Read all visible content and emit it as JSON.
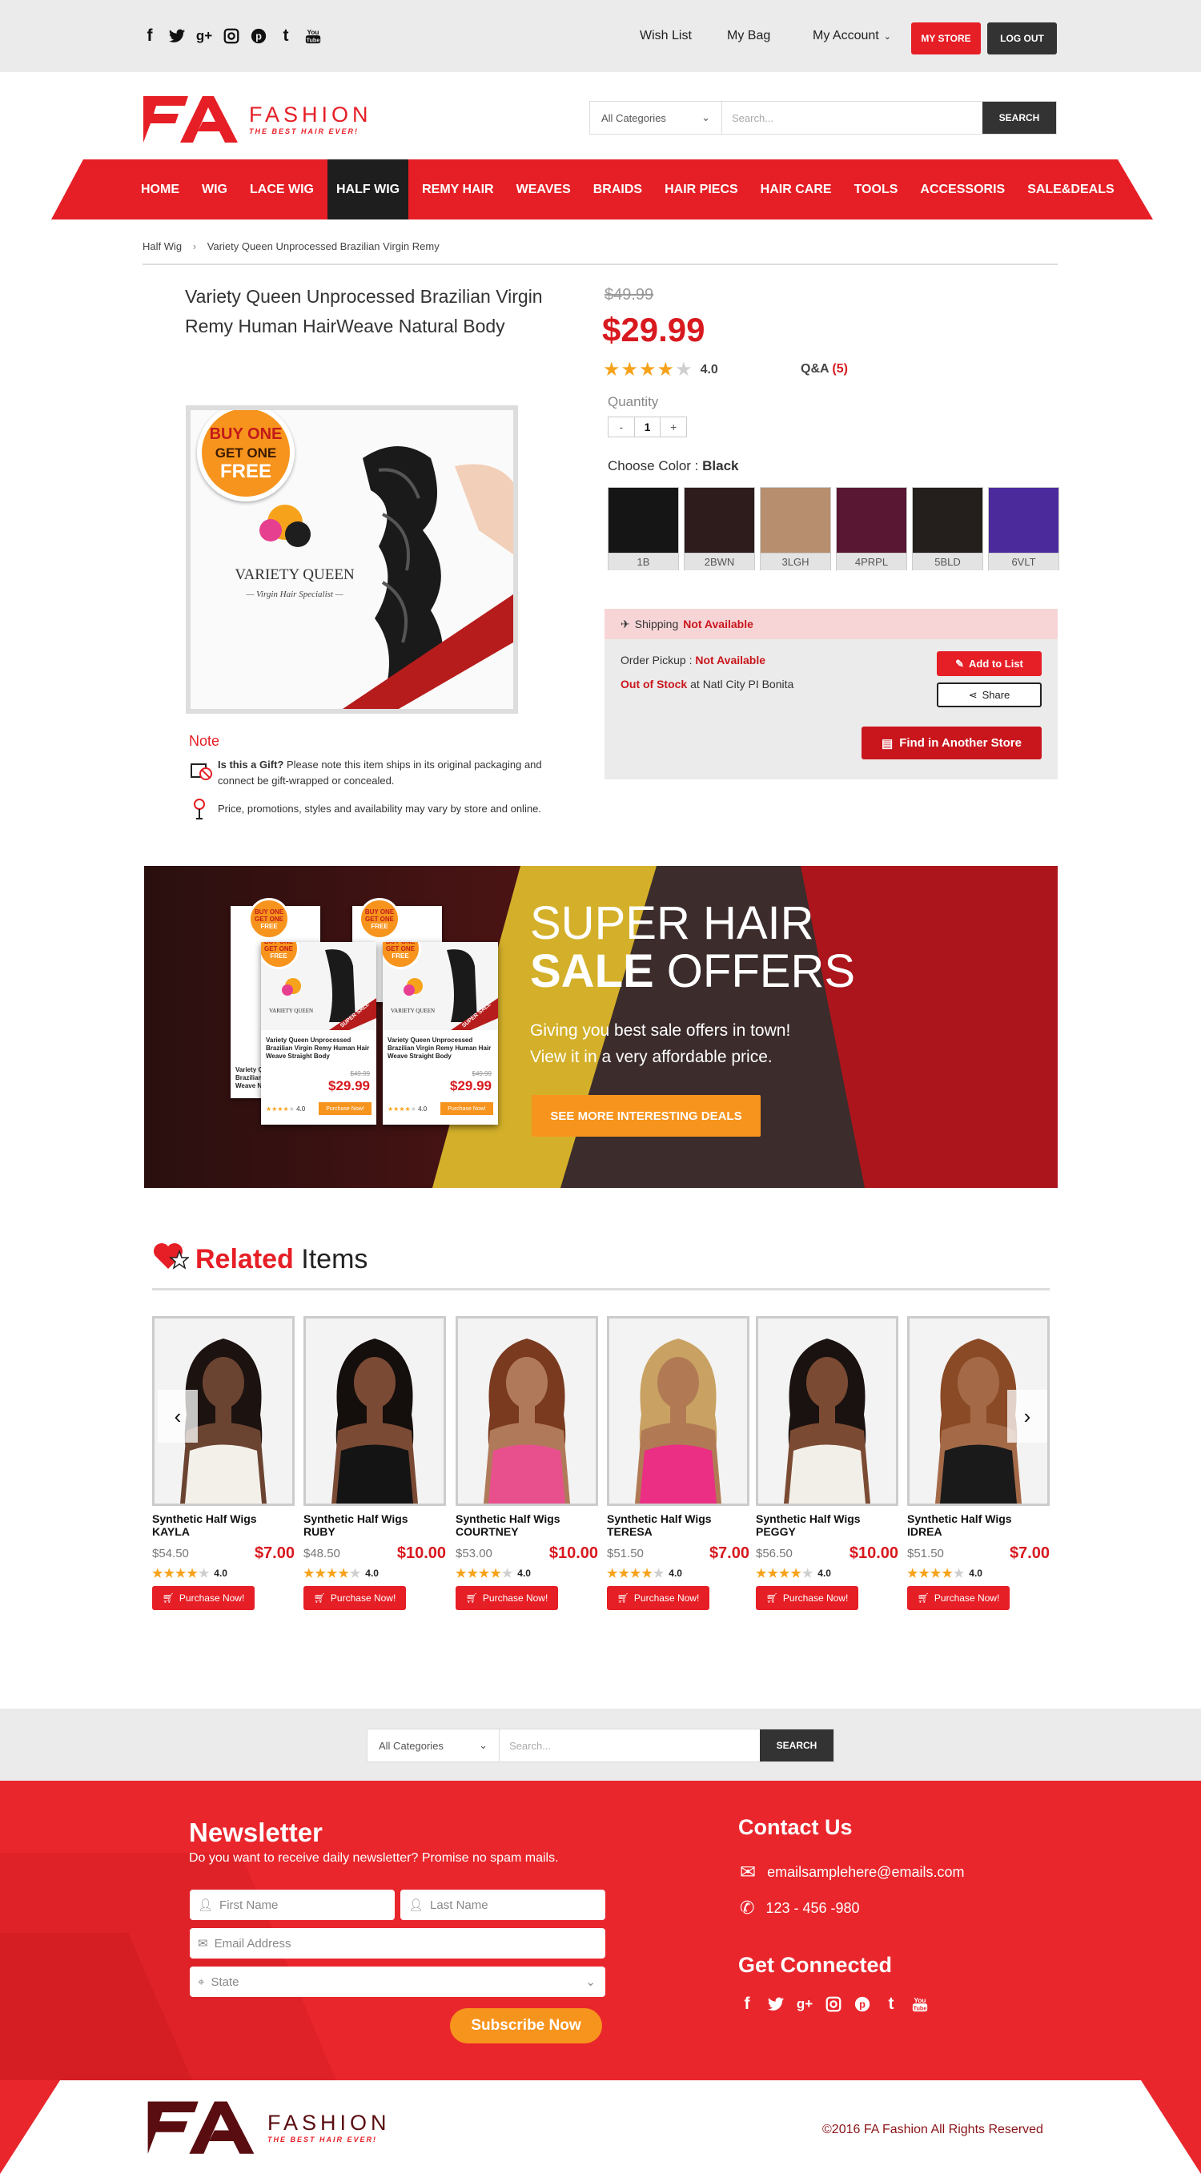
{
  "topbar": {
    "social": [
      "facebook-icon",
      "twitter-icon",
      "google-plus-icon",
      "instagram-icon",
      "pinterest-icon",
      "tumblr-icon",
      "youtube-icon"
    ],
    "wishlist": "Wish List",
    "bag": "My Bag",
    "account": "My Account",
    "my_store": "MY STORE",
    "logout": "LOG OUT"
  },
  "header": {
    "logo_mark": "FA",
    "logo_name": "FASHION",
    "logo_tagline": "THE BEST HAIR EVER!",
    "search_category": "All Categories",
    "search_placeholder": "Search...",
    "search_button": "SEARCH"
  },
  "nav": [
    {
      "label": "HOME"
    },
    {
      "label": "WIG"
    },
    {
      "label": "LACE WIG"
    },
    {
      "label": "HALF WIG",
      "active": true
    },
    {
      "label": "REMY HAIR"
    },
    {
      "label": "WEAVES"
    },
    {
      "label": "BRAIDS"
    },
    {
      "label": "HAIR PIECS"
    },
    {
      "label": "HAIR CARE"
    },
    {
      "label": "TOOLS"
    },
    {
      "label": "ACCESSORIS"
    },
    {
      "label": "SALE&DEALS"
    }
  ],
  "breadcrumb": {
    "parent": "Half Wig",
    "sep": "›",
    "current": "Variety Queen Unprocessed Brazilian Virgin Remy"
  },
  "product": {
    "title": "Variety Queen Unprocessed Brazilian Virgin Remy Human HairWeave Natural Body",
    "badge_line1": "BUY ONE",
    "badge_line2": "GET ONE",
    "badge_line3": "FREE",
    "brand_name": "VARIETY QUEEN",
    "brand_sub": "Virgin Hair Specialist",
    "old_price": "$49.99",
    "price": "$29.99",
    "rating": 4,
    "rating_text": "4.0",
    "qa_label": "Q&A",
    "qa_count": "(5)",
    "quantity_label": "Quantity",
    "quantity_minus": "-",
    "quantity_value": "1",
    "quantity_plus": "+",
    "color_label": "Choose Color : ",
    "color_selected": "Black",
    "swatches": [
      {
        "label": "1B",
        "color": "#151515"
      },
      {
        "label": "2BWN",
        "color": "#2e1c1c"
      },
      {
        "label": "3LGH",
        "color": "#b88f6e"
      },
      {
        "label": "4PRPL",
        "color": "#5a1734"
      },
      {
        "label": "5BLD",
        "color": "#241e1c"
      },
      {
        "label": "6VLT",
        "color": "#4b2b9c"
      }
    ],
    "note_title": "Note",
    "note_gift_bold": "Is this a Gift?",
    "note_gift": " Please note this item ships in its original packaging and connect be gift-wrapped or concealed.",
    "note_price": "Price, promotions, styles and availability may vary by store and online."
  },
  "shipping": {
    "label": "Shipping ",
    "status": "Not Available",
    "pickup_label": "Order Pickup : ",
    "pickup_status": "Not Available",
    "stock_status": "Out of Stock",
    "stock_store": " at Natl City PI Bonita",
    "add_to_list": "Add to List",
    "share": "Share",
    "find_store": "Find in Another Store"
  },
  "banner": {
    "line1": "SUPER HAIR",
    "line2_bold": "SALE",
    "line2_rest": " OFFERS",
    "desc1": "Giving you best sale offers in town!",
    "desc2": "View it in a very affordable price.",
    "cta": "SEE MORE INTERESTING DEALS",
    "mini_badge1": "BUY ONE",
    "mini_badge2": "GET ONE",
    "mini_badge3": "FREE",
    "mini_brand": "VARIETY QUEEN",
    "mini_ribbon": "SUPER SALE",
    "mini_title": "Variety Queen Unprocessed Brazilian Virgin Remy Human Hair Weave Straight Body",
    "mini_old": "$49.99",
    "mini_price": "$29.99",
    "mini_rating": "4.0",
    "mini_btn": "Purchase Now!",
    "back_title": "Variety Q Brazilian Weave N"
  },
  "related": {
    "title_bold": "Related",
    "title_rest": " Items",
    "buy_label": "Purchase Now!",
    "items": [
      {
        "line1": "Synthetic Half Wigs",
        "line2": "KAYLA",
        "old": "$54.50",
        "price": "$7.00",
        "rating": "4.0",
        "hair": "#1c1210",
        "skin": "#6b4431",
        "top": "#f3f0ea"
      },
      {
        "line1": "Synthetic Half Wigs",
        "line2": "RUBY",
        "old": "$48.50",
        "price": "$10.00",
        "rating": "4.0",
        "hair": "#140e0c",
        "skin": "#7a4a34",
        "top": "#141414"
      },
      {
        "line1": "Synthetic Half Wigs",
        "line2": "COURTNEY",
        "old": "$53.00",
        "price": "$10.00",
        "rating": "4.0",
        "hair": "#7a3a1f",
        "skin": "#b07a5a",
        "top": "#e8508d"
      },
      {
        "line1": "Synthetic Half Wigs",
        "line2": "TERESA",
        "old": "$51.50",
        "price": "$7.00",
        "rating": "4.0",
        "hair": "#c9a263",
        "skin": "#b17a55",
        "top": "#ea2f84"
      },
      {
        "line1": "Synthetic Half Wigs",
        "line2": "PEGGY",
        "old": "$56.50",
        "price": "$10.00",
        "rating": "4.0",
        "hair": "#1a1210",
        "skin": "#7b4a33",
        "top": "#f2efe8"
      },
      {
        "line1": "Synthetic Half Wigs",
        "line2": "IDREA",
        "old": "$51.50",
        "price": "$7.00",
        "rating": "4.0",
        "hair": "#8a4a25",
        "skin": "#a46a48",
        "top": "#1a1a1a"
      }
    ]
  },
  "footer_search": {
    "category": "All Categories",
    "placeholder": "Search...",
    "button": "SEARCH"
  },
  "newsletter": {
    "title": "Newsletter",
    "desc": "Do you want to receive daily newsletter? Promise no spam mails.",
    "first_name": "First Name",
    "last_name": "Last Name",
    "email": "Email Address",
    "state": "State",
    "submit": "Subscribe Now"
  },
  "contact": {
    "title": "Contact Us",
    "email": "emailsamplehere@emails.com",
    "phone": "123 - 456 -980",
    "connected": "Get Connected"
  },
  "copyright": "©2016 FA Fashion All Rights Reserved",
  "colors": {
    "brand_red": "#e61e25",
    "dark": "#333333",
    "orange": "#f7a21b",
    "footer_red": "#e9262c"
  }
}
